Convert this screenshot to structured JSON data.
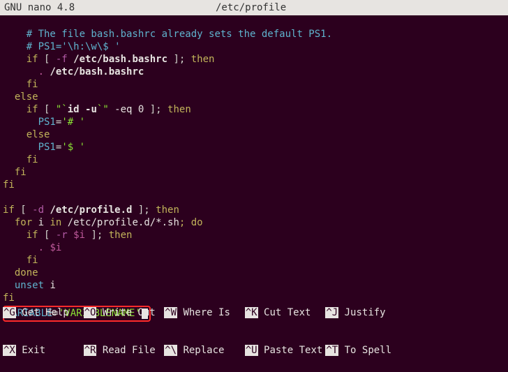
{
  "titlebar": {
    "app": "GNU nano 4.8",
    "filename": "/etc/profile"
  },
  "code": {
    "l1_comment": "# The file bash.bashrc already sets the default PS1.",
    "l2_comment": "# PS1='\\h:\\w\\$ '",
    "l3": {
      "if": "if",
      "br": " [ ",
      "opt": "-f",
      "path": " /etc/bash.bashrc",
      "close": " ]; ",
      "then": "then"
    },
    "l4": {
      "dot": ". ",
      "path": "/etc/bash.bashrc"
    },
    "l5_fi": "fi",
    "l6_else": "else",
    "l7": {
      "if": "if",
      "br": " [ ",
      "q1": "\"`",
      "cmd": "id -u",
      "q2": "`\"",
      "opt": " -eq",
      "num": " 0",
      "close": " ]; ",
      "then": "then"
    },
    "l8": {
      "var": "PS1",
      "eq": "=",
      "str": "'# '"
    },
    "l9_else": "else",
    "l10": {
      "var": "PS1",
      "eq": "=",
      "str": "'$ '"
    },
    "l11_fi": "fi",
    "l12_fi": "fi",
    "l13_fi": "fi",
    "l15": {
      "if": "if",
      "br": " [ ",
      "opt": "-d",
      "path": " /etc/profile.d",
      "close": " ]; ",
      "then": "then"
    },
    "l16": {
      "for": "for",
      "var": " i ",
      "in": "in",
      "path": " /etc/profile.d/*.sh",
      "do": "; do"
    },
    "l17": {
      "if": "if",
      "br": " [ ",
      "opt": "-r",
      "var": " $i",
      "close": " ]; ",
      "then": "then"
    },
    "l18": {
      "dot": ". ",
      "var": "$i"
    },
    "l19_fi": "fi",
    "l20_done": "done",
    "l21": {
      "unset": "unset",
      "var": " i"
    },
    "l22_fi": "fi",
    "newline": {
      "var": "VARIABLE",
      "eq": "=",
      "str": "'VARIABLENAME'"
    }
  },
  "shortcuts": {
    "row1": [
      {
        "key": "^G",
        "label": " Get Help  "
      },
      {
        "key": "^O",
        "label": " Write Out "
      },
      {
        "key": "^W",
        "label": " Where Is  "
      },
      {
        "key": "^K",
        "label": " Cut Text  "
      },
      {
        "key": "^J",
        "label": " Justify"
      }
    ],
    "row2": [
      {
        "key": "^X",
        "label": " Exit      "
      },
      {
        "key": "^R",
        "label": " Read File "
      },
      {
        "key": "^\\",
        "label": " Replace   "
      },
      {
        "key": "^U",
        "label": " Paste Text"
      },
      {
        "key": "^T",
        "label": " To Spell"
      }
    ]
  }
}
